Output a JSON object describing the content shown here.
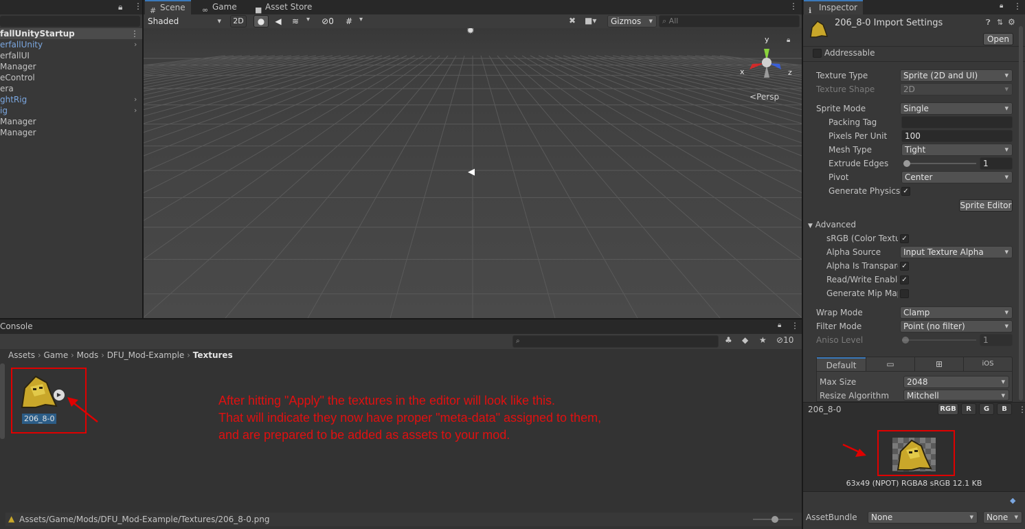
{
  "hierarchy": {
    "root": "fallUnityStartup",
    "items": [
      {
        "label": "erfallUnity",
        "blue": true,
        "arrow": true
      },
      {
        "label": "erfallUI",
        "blue": false,
        "arrow": false
      },
      {
        "label": "Manager",
        "blue": false,
        "arrow": false
      },
      {
        "label": "eControl",
        "blue": false,
        "arrow": false
      },
      {
        "label": "era",
        "blue": false,
        "arrow": false
      },
      {
        "label": "ghtRig",
        "blue": true,
        "arrow": true
      },
      {
        "label": "ig",
        "blue": true,
        "arrow": true
      },
      {
        "label": "Manager",
        "blue": false,
        "arrow": false
      },
      {
        "label": "Manager",
        "blue": false,
        "arrow": false
      }
    ]
  },
  "scene": {
    "tabs": {
      "scene": "Scene",
      "game": "Game",
      "asset_store": "Asset Store"
    },
    "shading": "Shaded",
    "mode2d": "2D",
    "hidden_count": "0",
    "gizmos": "Gizmos",
    "search_placeholder": "All",
    "persp": "Persp",
    "axes": {
      "x": "x",
      "y": "y",
      "z": "z"
    }
  },
  "console": {
    "tab": "Console",
    "hidden_count": "10",
    "breadcrumb": [
      "Assets",
      "Game",
      "Mods",
      "DFU_Mod-Example",
      "Textures"
    ],
    "asset_name": "206_8-0",
    "status_path": "Assets/Game/Mods/DFU_Mod-Example/Textures/206_8-0.png",
    "annotation_lines": [
      "After hitting \"Apply\" the textures in the editor will look like this.",
      "That will indicate they now have proper \"meta-data\" assigned to them,",
      "and are prepared to be added as assets to your mod."
    ]
  },
  "inspector": {
    "tab": "Inspector",
    "title": "206_8-0 Import Settings",
    "open": "Open",
    "addressable": "Addressable",
    "texture_type": {
      "label": "Texture Type",
      "value": "Sprite (2D and UI)"
    },
    "texture_shape": {
      "label": "Texture Shape",
      "value": "2D"
    },
    "sprite_mode": {
      "label": "Sprite Mode",
      "value": "Single"
    },
    "packing_tag": {
      "label": "Packing Tag",
      "value": ""
    },
    "pixels_per_unit": {
      "label": "Pixels Per Unit",
      "value": "100"
    },
    "mesh_type": {
      "label": "Mesh Type",
      "value": "Tight"
    },
    "extrude_edges": {
      "label": "Extrude Edges",
      "value": "1",
      "level": 0.0
    },
    "pivot": {
      "label": "Pivot",
      "value": "Center"
    },
    "generate_physics": {
      "label": "Generate Physics S"
    },
    "sprite_editor": "Sprite Editor",
    "advanced": "Advanced",
    "srgb": "sRGB (Color Textu",
    "alpha_source": {
      "label": "Alpha Source",
      "value": "Input Texture Alpha"
    },
    "alpha_transparency": "Alpha Is Transpare",
    "read_write": "Read/Write Enable",
    "gen_mip": "Generate Mip Map",
    "wrap_mode": {
      "label": "Wrap Mode",
      "value": "Clamp"
    },
    "filter_mode": {
      "label": "Filter Mode",
      "value": "Point (no filter)"
    },
    "aniso": {
      "label": "Aniso Level",
      "value": "1",
      "level": 0.0
    },
    "platform_tabs": {
      "default": "Default",
      "ios": "iOS"
    },
    "max_size": {
      "label": "Max Size",
      "value": "2048"
    },
    "resize_algorithm": {
      "label": "Resize Algorithm",
      "value": "Mitchell"
    },
    "preview": {
      "name": "206_8-0",
      "channels": [
        "RGB",
        "R",
        "G",
        "B"
      ],
      "info": "63x49 (NPOT)  RGBA8 sRGB  12.1 KB"
    },
    "asset_bundle": {
      "label": "AssetBundle",
      "value": "None",
      "variant": "None"
    }
  },
  "colors": {
    "accent": "#3a79bb",
    "annotation": "#e01010"
  }
}
